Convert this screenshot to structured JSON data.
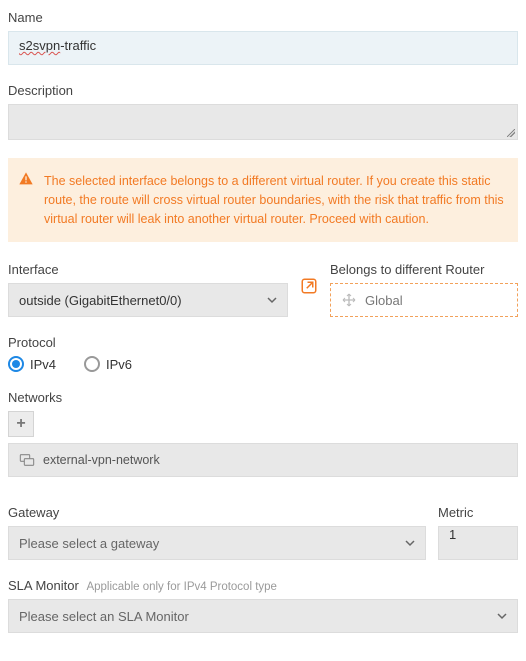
{
  "name": {
    "label": "Name",
    "value_pre": "s2svpn",
    "value_post": "-traffic"
  },
  "description": {
    "label": "Description"
  },
  "alert": {
    "text": "The selected interface belongs to a different virtual router. If you create this static route, the route will cross virtual router boundaries, with the risk that traffic from this virtual router will leak into another virtual router. Proceed with caution."
  },
  "interface": {
    "label": "Interface",
    "value": "outside (GigabitEthernet0/0)"
  },
  "belongs": {
    "label": "Belongs to different Router",
    "value": "Global"
  },
  "protocol": {
    "label": "Protocol",
    "options": {
      "ipv4": "IPv4",
      "ipv6": "IPv6"
    },
    "selected": "ipv4"
  },
  "networks": {
    "label": "Networks",
    "items": [
      "external-vpn-network"
    ]
  },
  "gateway": {
    "label": "Gateway",
    "placeholder": "Please select a gateway"
  },
  "metric": {
    "label": "Metric",
    "value": "1"
  },
  "sla": {
    "label": "SLA Monitor",
    "hint": "Applicable only for IPv4 Protocol type",
    "placeholder": "Please select an SLA Monitor"
  }
}
